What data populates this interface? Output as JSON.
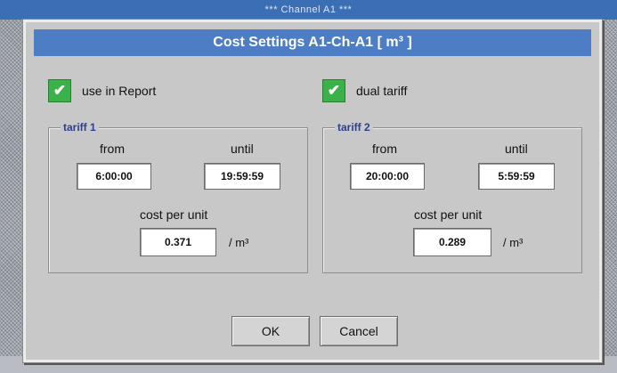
{
  "background": {
    "window_title": "*** Channel A1 ***"
  },
  "dialog": {
    "title": "Cost Settings A1-Ch-A1 [ m³ ]",
    "use_in_report": {
      "label": "use in Report",
      "checked": true,
      "mark": "✔"
    },
    "dual_tariff": {
      "label": "dual tariff",
      "checked": true,
      "mark": "✔"
    },
    "tariff1": {
      "legend": "tariff 1",
      "from_label": "from",
      "from_value": "6:00:00",
      "until_label": "until",
      "until_value": "19:59:59",
      "cost_label": "cost per unit",
      "cost_value": "0.371",
      "unit": "/ m³"
    },
    "tariff2": {
      "legend": "tariff 2",
      "from_label": "from",
      "from_value": "20:00:00",
      "until_label": "until",
      "until_value": "5:59:59",
      "cost_label": "cost per unit",
      "cost_value": "0.289",
      "unit": "/ m³"
    },
    "buttons": {
      "ok": "OK",
      "cancel": "Cancel"
    }
  },
  "colors": {
    "title_bar": "#4d7dc4",
    "checkbox_green": "#3bb14a",
    "legend_text": "#2d3f8f",
    "dialog_bg": "#c8c8c8"
  }
}
